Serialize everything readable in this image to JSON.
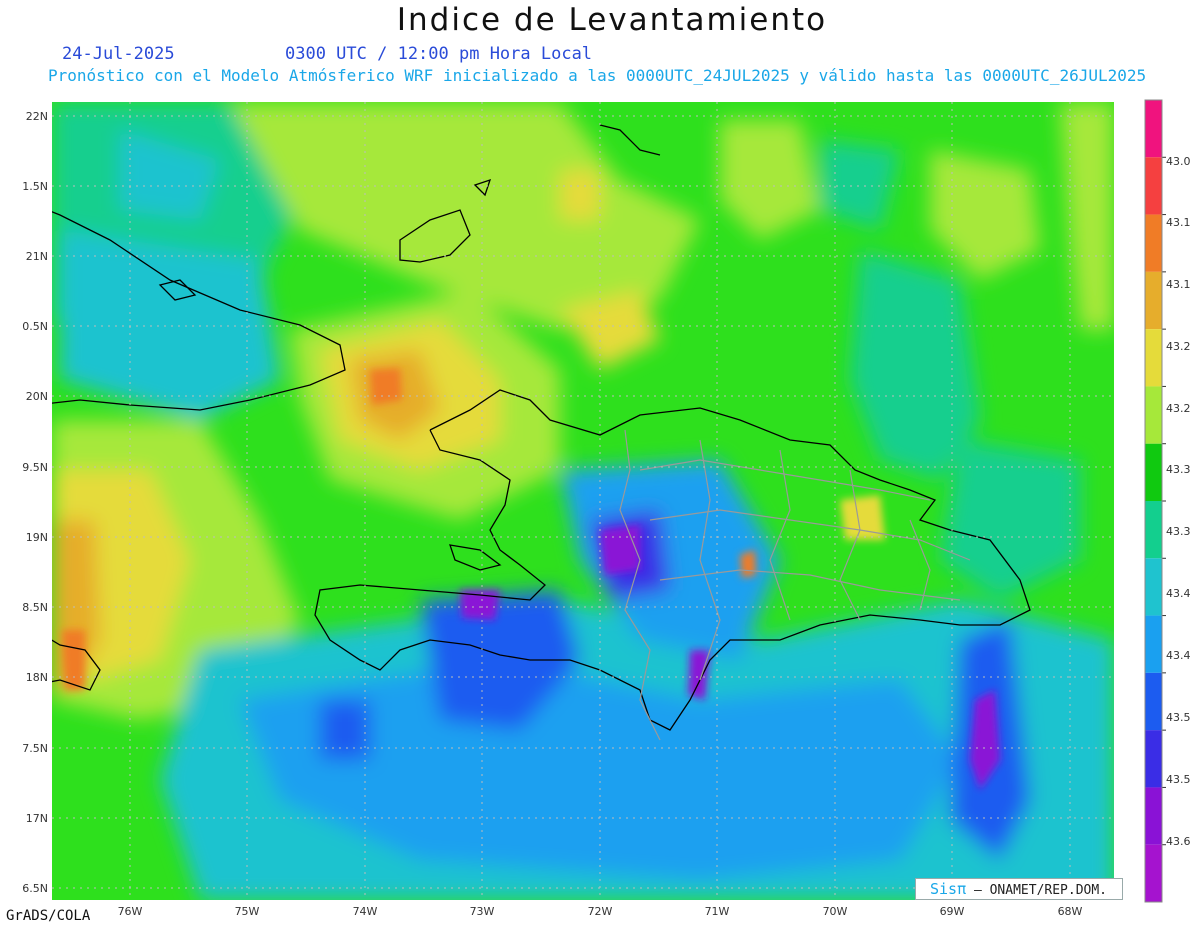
{
  "title": "Indice de Levantamiento",
  "date": "24-Jul-2025",
  "time_line": "0300 UTC / 12:00 pm Hora Local",
  "description": "Pronóstico con el Modelo Atmósferico WRF inicializado a las 0000UTC_24JUL2025 y válido hasta las  0000UTC_26JUL2025",
  "credit": "GrADS/COLA",
  "logo": {
    "sis": "Sisπ",
    "text": " – ONAMET/REP.DOM."
  },
  "axes": {
    "lat_labels": [
      "22N",
      "1.5N",
      "21N",
      "0.5N",
      "20N",
      "9.5N",
      "19N",
      "8.5N",
      "18N",
      "7.5N",
      "17N",
      "6.5N"
    ],
    "lon_labels": [
      "76W",
      "75W",
      "74W",
      "73W",
      "72W",
      "71W",
      "70W",
      "69W",
      "68W"
    ]
  },
  "colorbar": {
    "labels": [
      "43.0",
      "43.1",
      "43.1",
      "43.2",
      "43.2",
      "43.3",
      "43.3",
      "43.4",
      "43.4",
      "43.5",
      "43.5",
      "43.6"
    ],
    "colors": [
      "#f0137e",
      "#f54040",
      "#f07c26",
      "#e6ad2c",
      "#e5db3a",
      "#a6e83a",
      "#10c910",
      "#13cf8e",
      "#1fc3cf",
      "#1aa0f0",
      "#1c5cf0",
      "#3a2de6",
      "#8a12d6",
      "#a513cf"
    ]
  },
  "background_color": "#2ee01d"
}
